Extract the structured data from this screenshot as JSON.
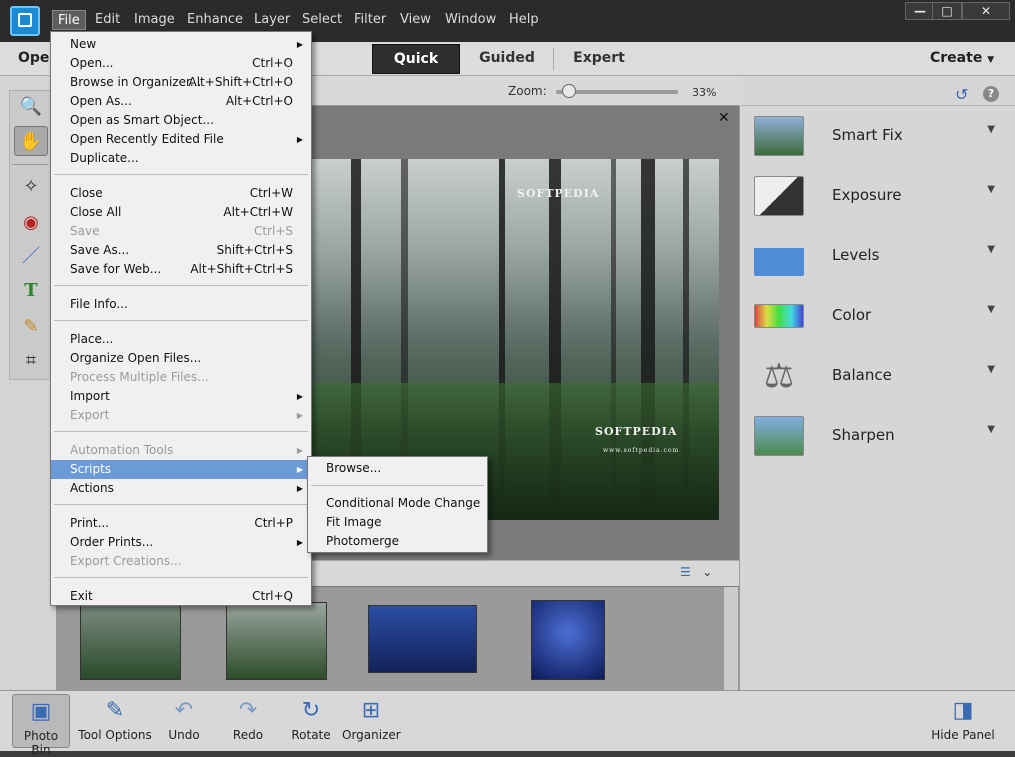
{
  "menubar": [
    "File",
    "Edit",
    "Image",
    "Enhance",
    "Layer",
    "Select",
    "Filter",
    "View",
    "Window",
    "Help"
  ],
  "window_controls": {
    "minimize": "—",
    "maximize": "□",
    "close": "✕"
  },
  "modebar": {
    "open_label": "Open",
    "tabs": [
      "Quick",
      "Guided",
      "Expert"
    ],
    "active_tab": "Quick",
    "create_label": "Create"
  },
  "zoom": {
    "label": "Zoom:",
    "value": "33%"
  },
  "doc_close": "✕",
  "watermarks": {
    "top": "SOFTPEDIA",
    "bottom": "SOFTPEDIA",
    "sub": "www.softpedia.com"
  },
  "file_menu": [
    {
      "label": "New",
      "shortcut": "",
      "arrow": "▶",
      "disabled": false
    },
    {
      "label": "Open...",
      "shortcut": "Ctrl+O",
      "arrow": "",
      "disabled": false
    },
    {
      "label": "Browse in Organizer...",
      "shortcut": "Alt+Shift+Ctrl+O",
      "arrow": "",
      "disabled": false
    },
    {
      "label": "Open As...",
      "shortcut": "Alt+Ctrl+O",
      "arrow": "",
      "disabled": false
    },
    {
      "label": "Open as Smart Object...",
      "shortcut": "",
      "arrow": "",
      "disabled": false
    },
    {
      "label": "Open Recently Edited File",
      "shortcut": "",
      "arrow": "▶",
      "disabled": false
    },
    {
      "label": "Duplicate...",
      "shortcut": "",
      "arrow": "",
      "disabled": false
    },
    {
      "label": "Close",
      "shortcut": "Ctrl+W",
      "arrow": "",
      "disabled": false
    },
    {
      "label": "Close All",
      "shortcut": "Alt+Ctrl+W",
      "arrow": "",
      "disabled": false
    },
    {
      "label": "Save",
      "shortcut": "Ctrl+S",
      "arrow": "",
      "disabled": true
    },
    {
      "label": "Save As...",
      "shortcut": "Shift+Ctrl+S",
      "arrow": "",
      "disabled": false
    },
    {
      "label": "Save for Web...",
      "shortcut": "Alt+Shift+Ctrl+S",
      "arrow": "",
      "disabled": false
    },
    {
      "label": "File Info...",
      "shortcut": "",
      "arrow": "",
      "disabled": false
    },
    {
      "label": "Place...",
      "shortcut": "",
      "arrow": "",
      "disabled": false
    },
    {
      "label": "Organize Open Files...",
      "shortcut": "",
      "arrow": "",
      "disabled": false
    },
    {
      "label": "Process Multiple Files...",
      "shortcut": "",
      "arrow": "",
      "disabled": true
    },
    {
      "label": "Import",
      "shortcut": "",
      "arrow": "▶",
      "disabled": false
    },
    {
      "label": "Export",
      "shortcut": "",
      "arrow": "▶",
      "disabled": true
    },
    {
      "label": "Automation Tools",
      "shortcut": "",
      "arrow": "▶",
      "disabled": true
    },
    {
      "label": "Scripts",
      "shortcut": "",
      "arrow": "▶",
      "disabled": false,
      "highlighted": true
    },
    {
      "label": "Actions",
      "shortcut": "",
      "arrow": "▶",
      "disabled": false
    },
    {
      "label": "Print...",
      "shortcut": "Ctrl+P",
      "arrow": "",
      "disabled": false
    },
    {
      "label": "Order Prints...",
      "shortcut": "",
      "arrow": "▶",
      "disabled": false
    },
    {
      "label": "Export Creations...",
      "shortcut": "",
      "arrow": "",
      "disabled": true
    },
    {
      "label": "Exit",
      "shortcut": "Ctrl+Q",
      "arrow": "",
      "disabled": false
    }
  ],
  "scripts_submenu": [
    "Browse...",
    "Conditional Mode Change",
    "Fit Image",
    "Photomerge"
  ],
  "quick_fixes": [
    "Smart Fix",
    "Exposure",
    "Levels",
    "Color",
    "Balance",
    "Sharpen"
  ],
  "bottombar": [
    "Photo Bin",
    "Tool Options",
    "Undo",
    "Redo",
    "Rotate",
    "Organizer",
    "Hide Panel"
  ],
  "colors": {
    "highlight": "#6b9ad6",
    "accent": "#3a6ab4"
  }
}
